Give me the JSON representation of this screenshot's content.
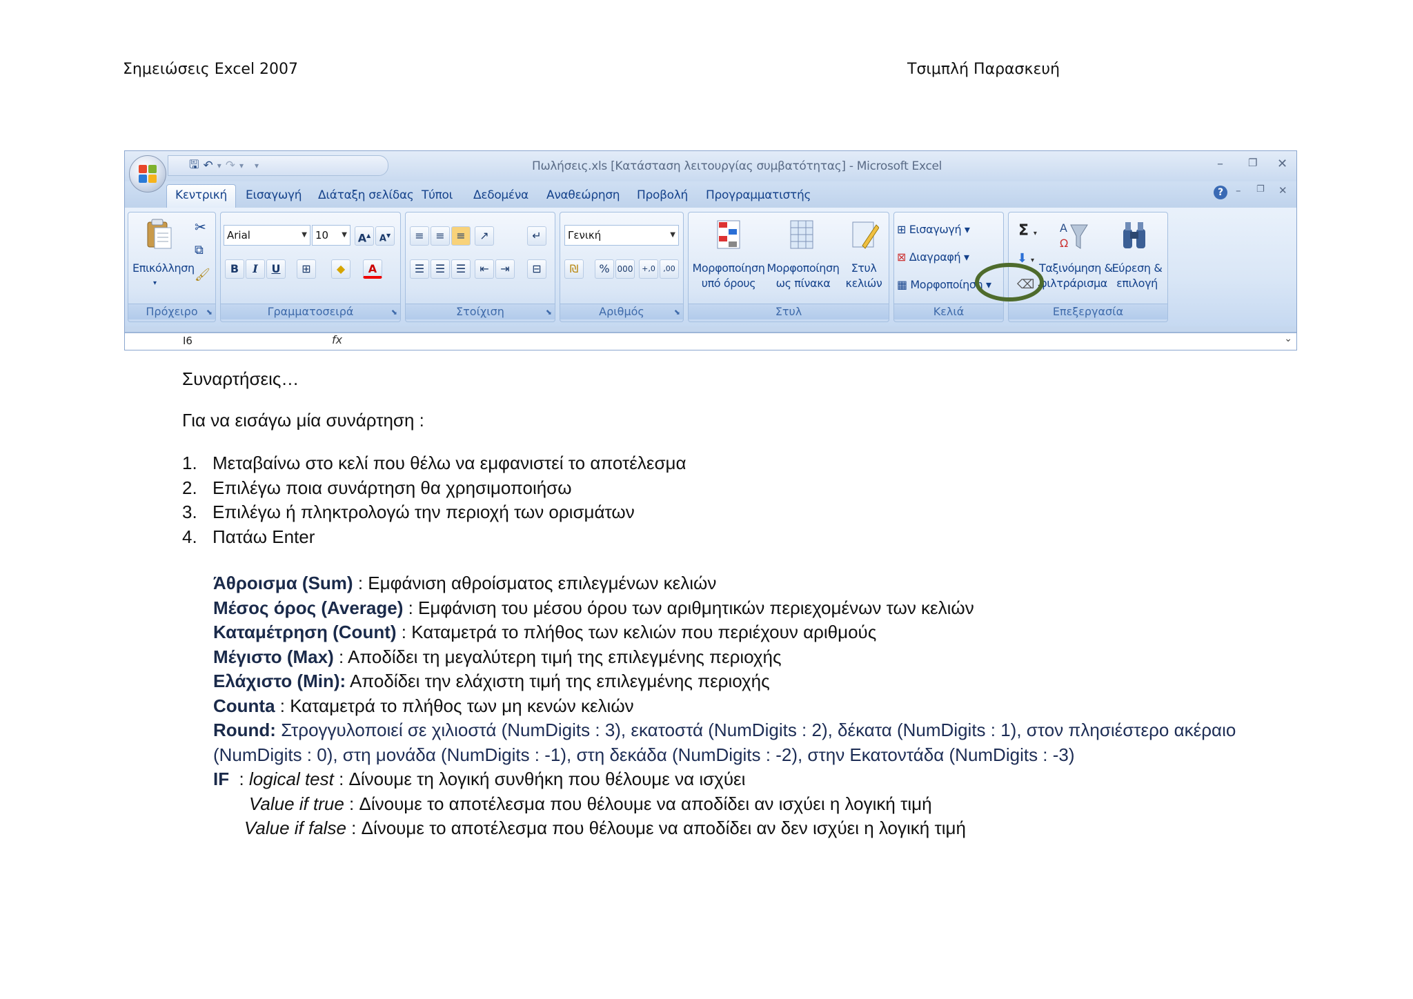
{
  "header": {
    "left": "Σημειώσεις Excel 2007",
    "right": "Τσιμπλή Παρασκευή"
  },
  "excel": {
    "window_title": "Πωλήσεις.xls [Κατάσταση λειτουργίας συμβατότητας] - Microsoft Excel",
    "tabs": [
      "Κεντρική",
      "Εισαγωγή",
      "Διάταξη σελίδας",
      "Τύποι",
      "Δεδομένα",
      "Αναθεώρηση",
      "Προβολή",
      "Προγραμματιστής"
    ],
    "clipboard": {
      "paste": "Επικόλληση",
      "label": "Πρόχειρο"
    },
    "font": {
      "name": "Arial",
      "size": "10",
      "label": "Γραμματοσειρά"
    },
    "alignment": {
      "label": "Στοίχιση"
    },
    "number": {
      "format": "Γενική",
      "percent": "%",
      "thousands": "000",
      "label": "Αριθμός"
    },
    "styles": {
      "conditional_1": "Μορφοποίηση",
      "conditional_2": "υπό όρους",
      "table_1": "Μορφοποίηση",
      "table_2": "ως πίνακα",
      "cell_1": "Στυλ",
      "cell_2": "κελιών",
      "label": "Στυλ"
    },
    "cells": {
      "insert": "Εισαγωγή",
      "delete": "Διαγραφή",
      "format": "Μορφοποίηση",
      "label": "Κελιά"
    },
    "editing": {
      "sort_1": "Ταξινόμηση &",
      "sort_2": "φιλτράρισμα",
      "find_1": "Εύρεση &",
      "find_2": "επιλογή",
      "label": "Επεξεργασία"
    },
    "namebox": "I6",
    "fx": "fx"
  },
  "doc": {
    "heading": "Συναρτήσεις…",
    "intro": "Για να εισάγω μία συνάρτηση :",
    "steps": [
      {
        "n": "1.",
        "text": "Μεταβαίνω στο κελί που θέλω να εμφανιστεί το αποτέλεσμα"
      },
      {
        "n": "2.",
        "text": "Επιλέγω ποια συνάρτηση θα χρησιμοποιήσω"
      },
      {
        "n": "3.",
        "text": "Επιλέγω ή πληκτρολογώ την περιοχή των ορισμάτων"
      },
      {
        "n": "4.",
        "text": "Πατάω Enter"
      }
    ],
    "defs": {
      "sum_term": "Άθροισμα (Sum)",
      "sum_text": " :  Εμφάνιση αθροίσματος επιλεγμένων κελιών",
      "avg_term": "Μέσος όρος (Average)",
      "avg_text": " : Εμφάνιση του μέσου όρου των αριθμητικών περιεχομένων των κελιών",
      "count_term": "Καταμέτρηση (Count)",
      "count_text": " : Καταμετρά το πλήθος των κελιών που περιέχουν αριθμούς",
      "max_term": "Μέγιστο (Max)",
      "max_text": " : Αποδίδει τη μεγαλύτερη τιμή της επιλεγμένης περιοχής",
      "min_term": "Ελάχιστο (Min):",
      "min_text": " Αποδίδει την ελάχιστη τιμή της επιλεγμένης περιοχής",
      "counta_term": "Counta",
      "counta_text": " : Καταμετρά το πλήθος των μη κενών κελιών",
      "round_term": "Round:",
      "round_text1": " Στρογγυλοποιεί σε χιλιοστά (NumDigits : 3), εκατοστά (NumDigits : 2), δέκατα (NumDigits : 1), στον πλησιέστερο ακέραιο",
      "round_text2": "(NumDigits : 0), στη μονάδα  (NumDigits : -1),  στη δεκάδα (NumDigits : -2), στην Εκατοντάδα (NumDigits : -3)",
      "if_term": "IF",
      "if_sep": "  : ",
      "if_logical": "logical test",
      "if_logical_text": " : Δίνουμε τη λογική συνθήκη που θέλουμε να ισχύει",
      "if_true": "Value if true",
      "if_true_text": " : Δίνουμε το αποτέλεσμα που θέλουμε να αποδίδει αν ισχύει η λογική τιμή",
      "if_false": "Value if false",
      "if_false_text": " : Δίνουμε το αποτέλεσμα που θέλουμε να αποδίδει αν δεν ισχύει η λογική τιμή"
    }
  }
}
